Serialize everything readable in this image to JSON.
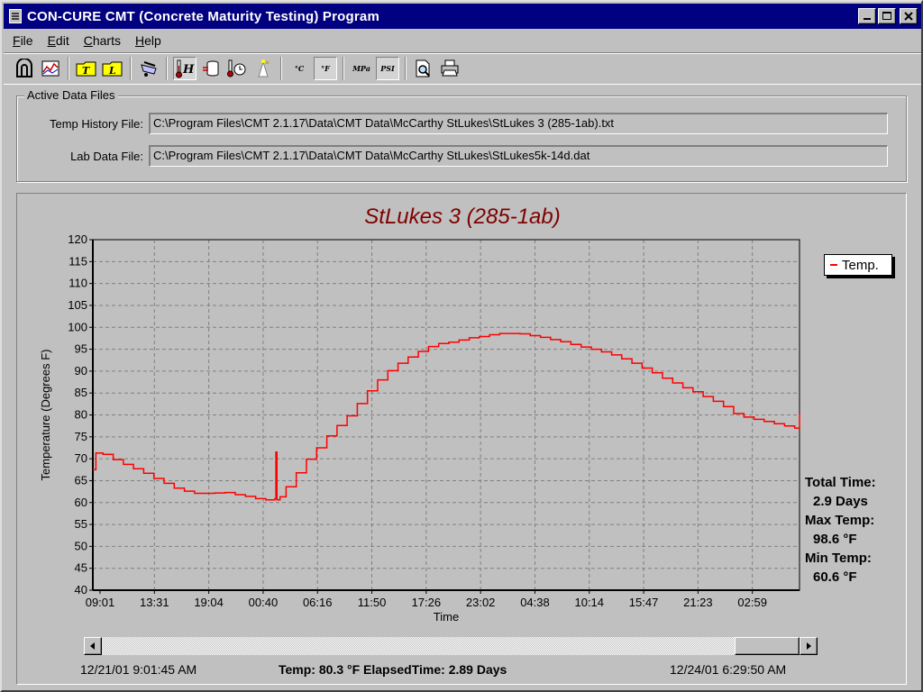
{
  "window": {
    "title": "CON-CURE CMT (Concrete Maturity Testing) Program"
  },
  "menu": [
    {
      "label": "File",
      "accel": "F"
    },
    {
      "label": "Edit",
      "accel": "E"
    },
    {
      "label": "Charts",
      "accel": "C"
    },
    {
      "label": "Help",
      "accel": "H"
    }
  ],
  "toolbar": {
    "temp_c_label": "°C",
    "temp_f_label": "°F",
    "mpa_label": "MPa",
    "psi_label": "PSI"
  },
  "active_files": {
    "group_label": "Active Data Files",
    "temp_history_label": "Temp History File:",
    "temp_history_value": "C:\\Program Files\\CMT 2.1.17\\Data\\CMT Data\\McCarthy StLukes\\StLukes 3 (285-1ab).txt",
    "lab_data_label": "Lab Data File:",
    "lab_data_value": "C:\\Program Files\\CMT 2.1.17\\Data\\CMT Data\\McCarthy StLukes\\StLukes5k-14d.dat"
  },
  "legend": {
    "label": "Temp."
  },
  "stats": {
    "total_time_label": "Total Time:",
    "total_time_value": "2.9 Days",
    "max_temp_label": "Max Temp:",
    "max_temp_value": "98.6 °F",
    "min_temp_label": "Min Temp:",
    "min_temp_value": "60.6 °F"
  },
  "status": {
    "start": "12/21/01 9:01:45 AM",
    "readout": "Temp:  80.3 °F  ElapsedTime:  2.89 Days",
    "end": "12/24/01 6:29:50 AM"
  },
  "colors": {
    "title_bar": "#000080",
    "series": "#ff0000",
    "chart_title": "#800000"
  },
  "chart_data": {
    "type": "line",
    "title": "StLukes 3 (285-1ab)",
    "xlabel": "Time",
    "ylabel": "Temperature (Degrees F)",
    "ylim": [
      40,
      120
    ],
    "yticks": [
      40,
      45,
      50,
      55,
      60,
      65,
      70,
      75,
      80,
      85,
      90,
      95,
      100,
      105,
      110,
      115,
      120
    ],
    "xticks": [
      "09:01",
      "13:31",
      "19:04",
      "00:40",
      "06:16",
      "11:50",
      "17:26",
      "23:02",
      "04:38",
      "10:14",
      "15:47",
      "21:23",
      "02:59"
    ],
    "grid": true,
    "legend_position": "right",
    "series": [
      {
        "name": "Temp.",
        "x_hours": [
          0,
          0.3,
          1,
          2,
          3,
          4,
          5,
          6,
          7,
          8,
          9,
          10,
          12,
          13,
          14,
          15,
          16,
          17,
          17.9,
          18,
          18.1,
          18.4,
          19,
          20,
          21,
          22,
          23,
          24,
          25,
          26,
          27,
          28,
          29,
          30,
          31,
          32,
          33,
          34,
          35,
          36,
          37,
          38,
          39,
          40,
          41,
          42,
          43,
          44,
          45,
          46,
          47,
          48,
          49,
          50,
          51,
          52,
          53,
          54,
          55,
          56,
          57,
          58,
          59,
          60,
          61,
          62,
          63,
          64,
          65,
          66,
          67,
          68,
          69,
          69.47
        ],
        "values": [
          67.5,
          71.3,
          71,
          69.8,
          68.7,
          67.7,
          66.7,
          65.5,
          64.4,
          63.3,
          62.6,
          62.1,
          62.2,
          62.3,
          61.8,
          61.4,
          60.9,
          60.6,
          60.9,
          71.5,
          60.6,
          61.3,
          63.6,
          66.8,
          69.9,
          72.5,
          75.2,
          77.6,
          79.8,
          82.6,
          85.5,
          88.0,
          90.1,
          91.8,
          93.2,
          94.5,
          95.6,
          96.3,
          96.6,
          97.1,
          97.6,
          97.9,
          98.3,
          98.6,
          98.6,
          98.5,
          98.1,
          97.7,
          97.2,
          96.7,
          96.1,
          95.5,
          95.0,
          94.4,
          93.7,
          92.8,
          91.8,
          90.7,
          89.6,
          88.4,
          87.3,
          86.2,
          85.3,
          84.2,
          83.1,
          81.9,
          80.3,
          79.5,
          79.0,
          78.5,
          78.0,
          77.5,
          77.0,
          80.3
        ]
      }
    ]
  }
}
